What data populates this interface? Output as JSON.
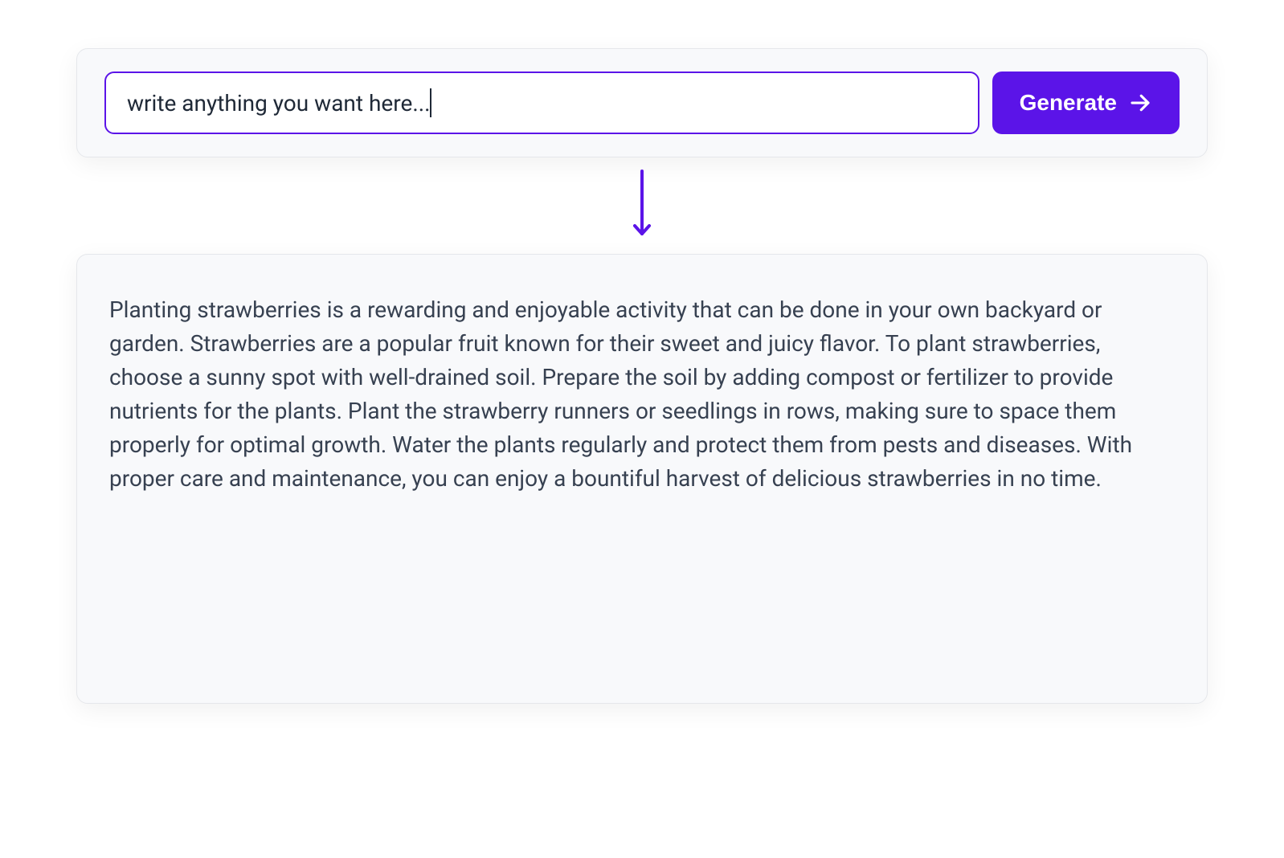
{
  "input": {
    "value": "write anything you want here...",
    "placeholder": "write anything you want here..."
  },
  "button": {
    "generate_label": "Generate"
  },
  "output": {
    "text": "Planting strawberries is a rewarding and enjoyable activity that can be done in your own backyard or garden. Strawberries are a popular fruit known for their sweet and juicy flavor. To plant strawberries, choose a sunny spot with well-drained soil. Prepare the soil by adding compost or fertilizer to provide nutrients for the plants. Plant the strawberry runners or seedlings in rows, making sure to space them properly for optimal growth. Water the plants regularly and protect them from pests and diseases. With proper care and maintenance, you can enjoy a bountiful harvest of delicious strawberries in no time."
  },
  "colors": {
    "accent": "#5b14e8",
    "panel_bg": "#f8f9fb",
    "border": "#e5e7eb",
    "text": "#374151"
  }
}
